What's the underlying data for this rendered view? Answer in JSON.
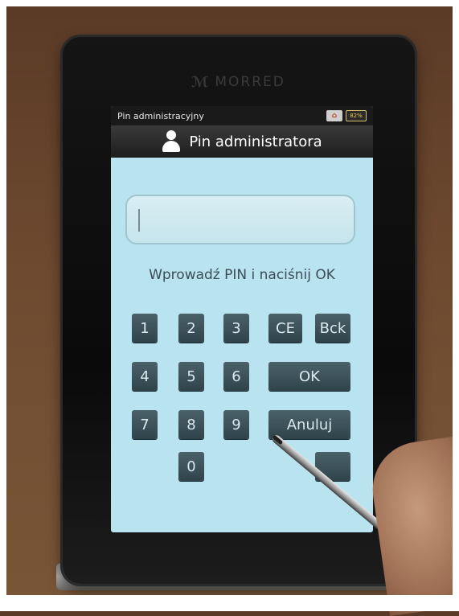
{
  "device": {
    "brand": "MORRED"
  },
  "statusbar": {
    "title": "Pin administracyjny",
    "battery": "82%"
  },
  "titlebar": {
    "title": "Pin administratora"
  },
  "pin_input": {
    "value": ""
  },
  "prompt": "Wprowadź PIN i naciśnij OK",
  "keypad": {
    "k1": "1",
    "k2": "2",
    "k3": "3",
    "k4": "4",
    "k5": "5",
    "k6": "6",
    "k7": "7",
    "k8": "8",
    "k9": "9",
    "k0": "0",
    "ce": "CE",
    "bck": "Bck",
    "ok": "OK",
    "cancel": "Anuluj"
  },
  "colors": {
    "screen": "#b9e3ee",
    "key": "#3a4f57",
    "bar": "#1a1a1a"
  }
}
